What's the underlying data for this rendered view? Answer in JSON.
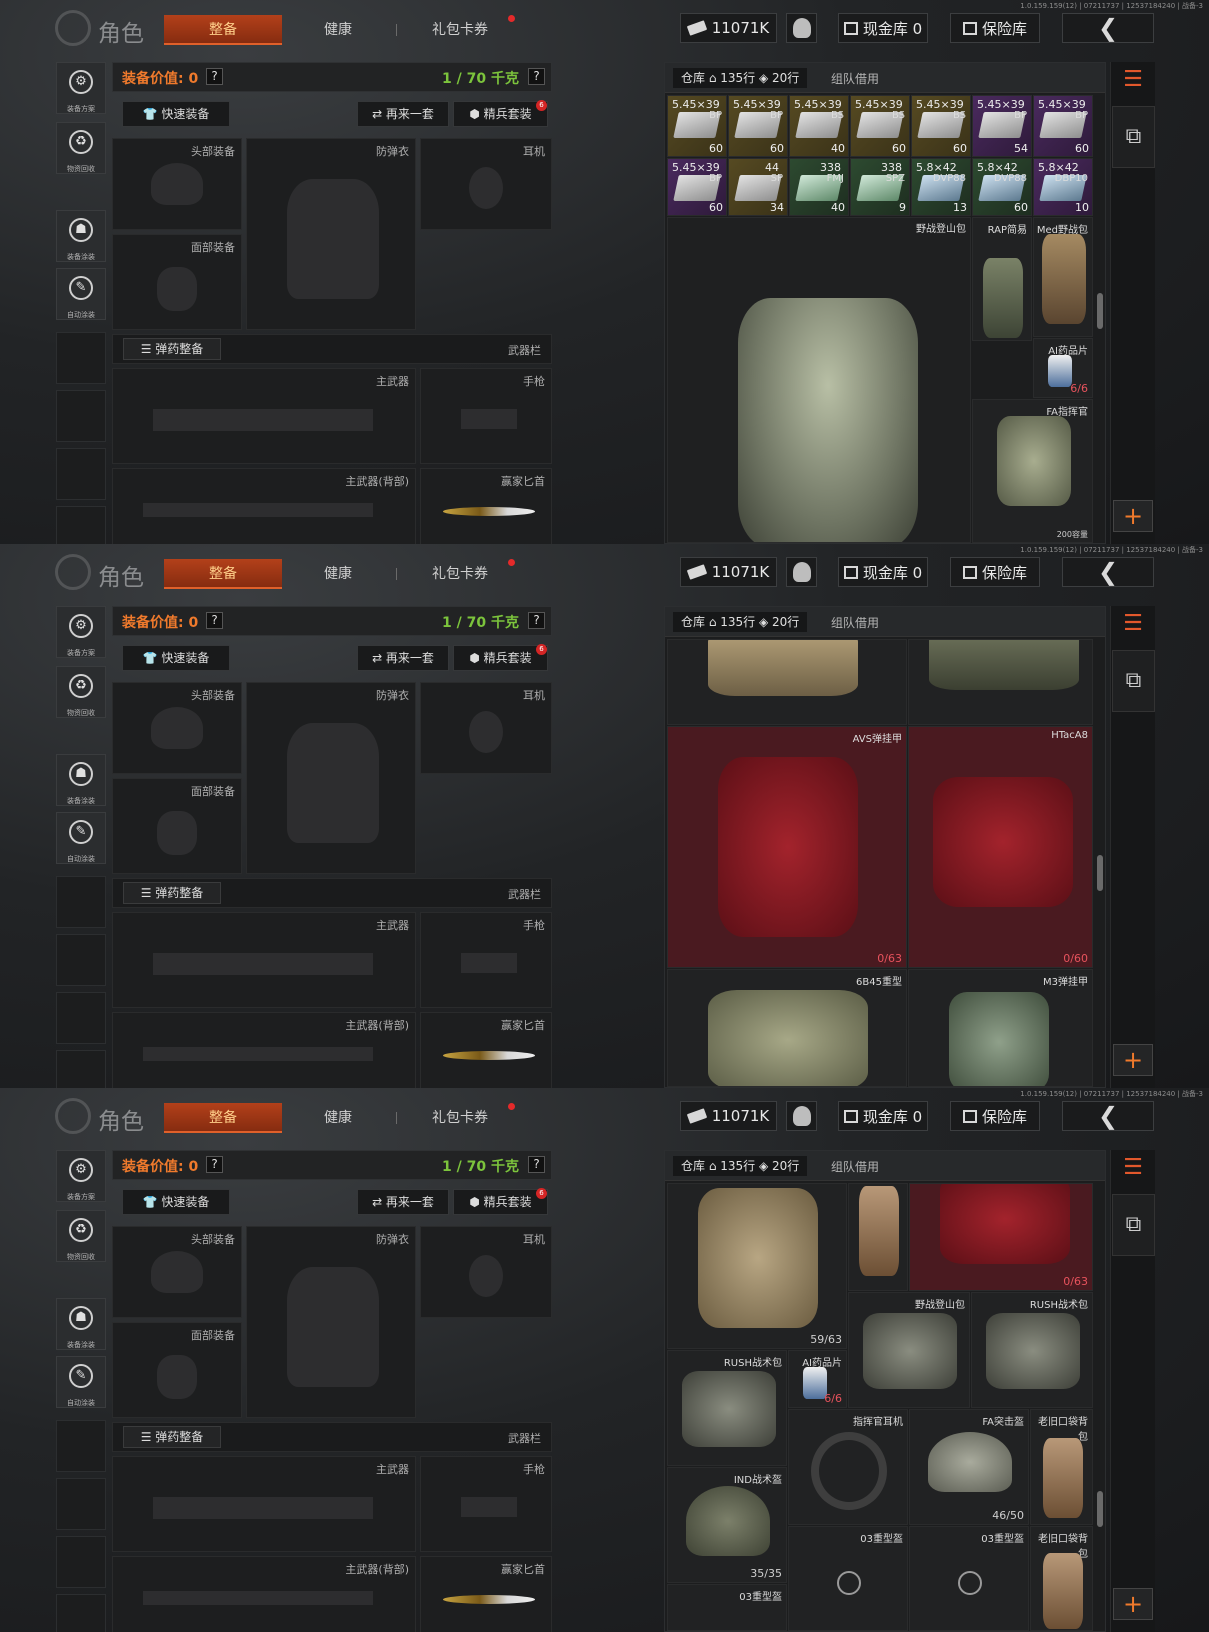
{
  "version": "1.0.159.159(12) | 07211737 | 12537184240 | 战备-3",
  "title": "角色",
  "tabs": {
    "active": "整备",
    "health": "健康",
    "gift": "礼包卡券"
  },
  "money": "11071K",
  "cash": "现金库 0",
  "safe": "保险库",
  "back": "❮",
  "sidebar": {
    "plan": "装备方案",
    "recycle": "物资回收",
    "paint": "装备涂装",
    "auto": "自动涂装"
  },
  "header": {
    "gear_value": "装备价值: 0",
    "weight": "1 / 70 千克",
    "q": "?"
  },
  "buttons": {
    "quick": "👕 快速装备",
    "again": "⇄ 再来一套",
    "elite": "⬢ 精兵套装",
    "badge": "6"
  },
  "slots": {
    "head": "头部装备",
    "armor": "防弹衣",
    "ear": "耳机",
    "face": "面部装备",
    "ammo": "☰ 弹药整备",
    "weapon_bar": "武器栏",
    "main": "主武器",
    "pistol": "手枪",
    "main_back": "主武器(背部)",
    "knife": "赢家匕首"
  },
  "storage": {
    "rows": "135行",
    "rows2": "20行",
    "warehouse": "仓库",
    "team": "组队借用"
  },
  "panel1": {
    "ammo_row1": [
      {
        "t": "5.45×39",
        "n": "BP",
        "c": "60"
      },
      {
        "t": "5.45×39",
        "n": "BP",
        "c": "60"
      },
      {
        "t": "5.45×39",
        "n": "BS",
        "c": "40"
      },
      {
        "t": "5.45×39",
        "n": "BS",
        "c": "60"
      },
      {
        "t": "5.45×39",
        "n": "BS",
        "c": "60"
      },
      {
        "t": "5.45×39",
        "n": "BP",
        "c": "54"
      },
      {
        "t": "5.45×39",
        "n": "BP",
        "c": "60"
      }
    ],
    "ammo_row2": [
      {
        "t": "5.45×39",
        "n": "BP",
        "c": "60"
      },
      {
        "t": "44",
        "n": "SP",
        "c": "34"
      },
      {
        "t": "338",
        "n": "FMJ",
        "c": "40"
      },
      {
        "t": "338",
        "n": "SPZ",
        "c": "9"
      },
      {
        "t": "5.8×42",
        "n": "DVP88",
        "c": "13"
      },
      {
        "t": "5.8×42",
        "n": "DVP88",
        "c": "60"
      },
      {
        "t": "5.8×42",
        "n": "DBP10",
        "c": "10"
      }
    ],
    "items": {
      "field_pack": "野战登山包",
      "rap": "RAP简易",
      "med": "Med野战包",
      "pills": "AI药品片",
      "pills_count": "6/6",
      "fa": "FA指挥官",
      "more": "200容量"
    }
  },
  "panel2": {
    "avs": "AVS弹挂甲",
    "avs_count": "0/63",
    "htac": "HTacA8",
    "htac_count": "0/60",
    "heavy": "6B45重型",
    "m3": "M3弹挂甲"
  },
  "panel3": {
    "c1": "59/63",
    "c2": "0/63",
    "field_pack": "野战登山包",
    "rush1": "RUSH战术包",
    "rush2": "RUSH战术包",
    "pills": "AI药品片",
    "pills_count": "6/6",
    "headset": "指挥官耳机",
    "fa_helmet": "FA突击盔",
    "old_bag": "老旧口袋背包",
    "ind": "IND战术盔",
    "fa_count": "46/50",
    "ind_count": "35/35",
    "h03a": "03重型盔",
    "h03b": "03重型盔",
    "old_bag2": "老旧口袋背包",
    "h03c": "03重型盔"
  }
}
